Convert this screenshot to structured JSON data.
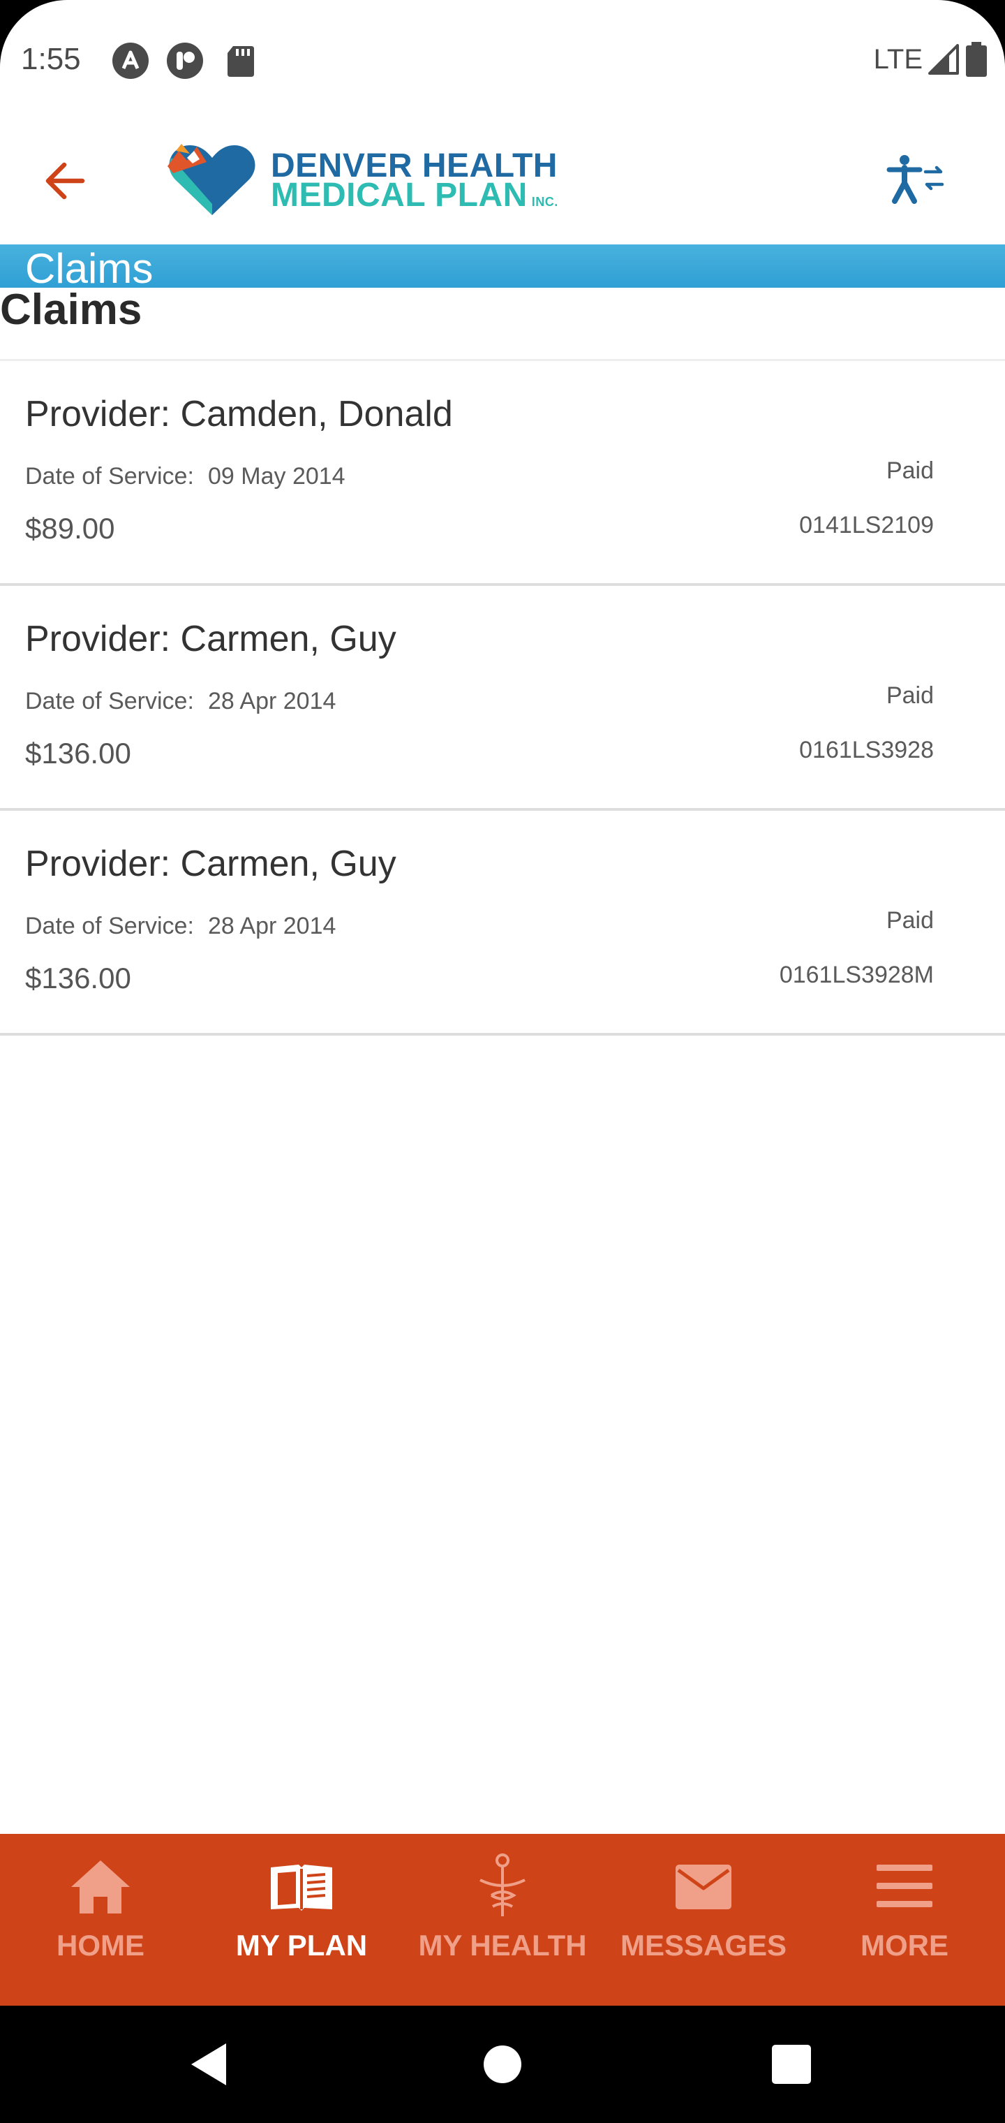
{
  "status_bar": {
    "time": "1:55",
    "network": "LTE"
  },
  "header": {
    "logo_line1": "DENVER HEALTH",
    "logo_line2": "MEDICAL PLAN",
    "logo_suffix": "INC.",
    "back_icon": "arrow-left-icon",
    "accessibility_icon": "accessibility-icon"
  },
  "page": {
    "banner_title": "Claims",
    "heading": "Claims"
  },
  "claims": [
    {
      "provider": "Provider: Camden, Donald",
      "date_label": "Date of Service:",
      "date": "09 May 2014",
      "amount": "$89.00",
      "status": "Paid",
      "claim_number": "0141LS2109"
    },
    {
      "provider": "Provider: Carmen, Guy",
      "date_label": "Date of Service:",
      "date": "28 Apr 2014",
      "amount": "$136.00",
      "status": "Paid",
      "claim_number": "0161LS3928"
    },
    {
      "provider": "Provider: Carmen, Guy",
      "date_label": "Date of Service:",
      "date": "28 Apr 2014",
      "amount": "$136.00",
      "status": "Paid",
      "claim_number": "0161LS3928M"
    }
  ],
  "bottom_nav": [
    {
      "label": "HOME",
      "icon": "home-icon",
      "active": false
    },
    {
      "label": "MY PLAN",
      "icon": "book-icon",
      "active": true
    },
    {
      "label": "MY HEALTH",
      "icon": "caduceus-icon",
      "active": false
    },
    {
      "label": "MESSAGES",
      "icon": "envelope-icon",
      "active": false
    },
    {
      "label": "MORE",
      "icon": "menu-icon",
      "active": false
    }
  ],
  "colors": {
    "brand_orange": "#cf4318",
    "banner_blue": "#2f9fd4",
    "logo_blue": "#1f6aa3",
    "logo_teal": "#2dbbb2",
    "nav_inactive": "#f0a088"
  }
}
